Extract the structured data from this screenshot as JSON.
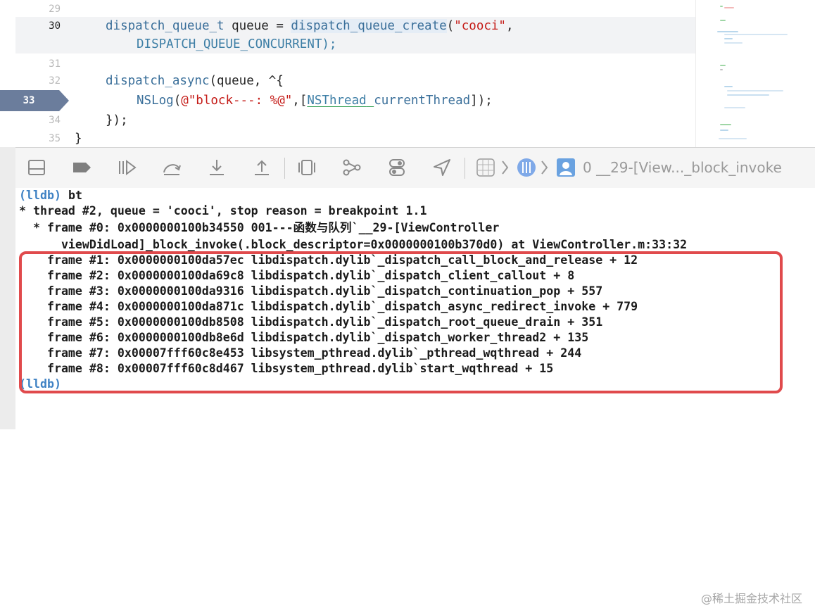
{
  "editor": {
    "lines": [
      {
        "num": "29",
        "code": ""
      },
      {
        "num": "30",
        "code_parts": [
          "dispatch_queue_t",
          " queue = ",
          "dispatch_queue_create",
          "(",
          "\"cooci\"",
          ","
        ],
        "continuation": "DISPATCH_QUEUE_CONCURRENT);"
      },
      {
        "num": "31",
        "code": ""
      },
      {
        "num": "32",
        "code_parts": [
          "dispatch_async",
          "(queue, ^{"
        ]
      },
      {
        "num": "33",
        "code_parts": [
          "NSLog",
          "(",
          "@\"block---: %@\"",
          ",[",
          "NSThread",
          " ",
          "currentThread",
          "]);"
        ]
      },
      {
        "num": "34",
        "code": "});"
      },
      {
        "num": "35",
        "code": "}"
      }
    ],
    "breakpoint_line": "33",
    "breakpoint_color": "#6b7d9c"
  },
  "debugbar": {
    "buttons": [
      "hide-console-icon",
      "breakpoints-toggle-icon",
      "continue-icon",
      "step-over-icon",
      "step-into-icon",
      "step-out-icon",
      "view-debugger-icon",
      "memory-graph-icon",
      "environment-overrides-icon",
      "simulate-location-icon"
    ],
    "breadcrumb": {
      "thread_icon": "thread-icon",
      "frame_label": "0 __29-[View..._block_invoke"
    }
  },
  "console": {
    "lines": [
      {
        "text": "(lldb) bt",
        "kind": "prompt-cmd"
      },
      {
        "text": "* thread #2, queue = 'cooci', stop reason = breakpoint 1.1"
      },
      {
        "text": "  * frame #0: 0x0000000100b34550 001---函数与队列`__29-[ViewController"
      },
      {
        "text": "      viewDidLoad]_block_invoke(.block_descriptor=0x0000000100b370d0) at ViewController.m:33:32"
      },
      {
        "text": "    frame #1: 0x0000000100da57ec libdispatch.dylib`_dispatch_call_block_and_release + 12"
      },
      {
        "text": "    frame #2: 0x0000000100da69c8 libdispatch.dylib`_dispatch_client_callout + 8"
      },
      {
        "text": "    frame #3: 0x0000000100da9316 libdispatch.dylib`_dispatch_continuation_pop + 557"
      },
      {
        "text": "    frame #4: 0x0000000100da871c libdispatch.dylib`_dispatch_async_redirect_invoke + 779"
      },
      {
        "text": "    frame #5: 0x0000000100db8508 libdispatch.dylib`_dispatch_root_queue_drain + 351"
      },
      {
        "text": "    frame #6: 0x0000000100db8e6d libdispatch.dylib`_dispatch_worker_thread2 + 135"
      },
      {
        "text": "    frame #7: 0x00007fff60c8e453 libsystem_pthread.dylib`_pthread_wqthread + 244"
      },
      {
        "text": "    frame #8: 0x00007fff60c8d467 libsystem_pthread.dylib`start_wqthread + 15"
      },
      {
        "text": "(lldb)",
        "kind": "prompt"
      }
    ],
    "highlight_color": "#e04a4c"
  },
  "watermark": "@稀土掘金技术社区"
}
